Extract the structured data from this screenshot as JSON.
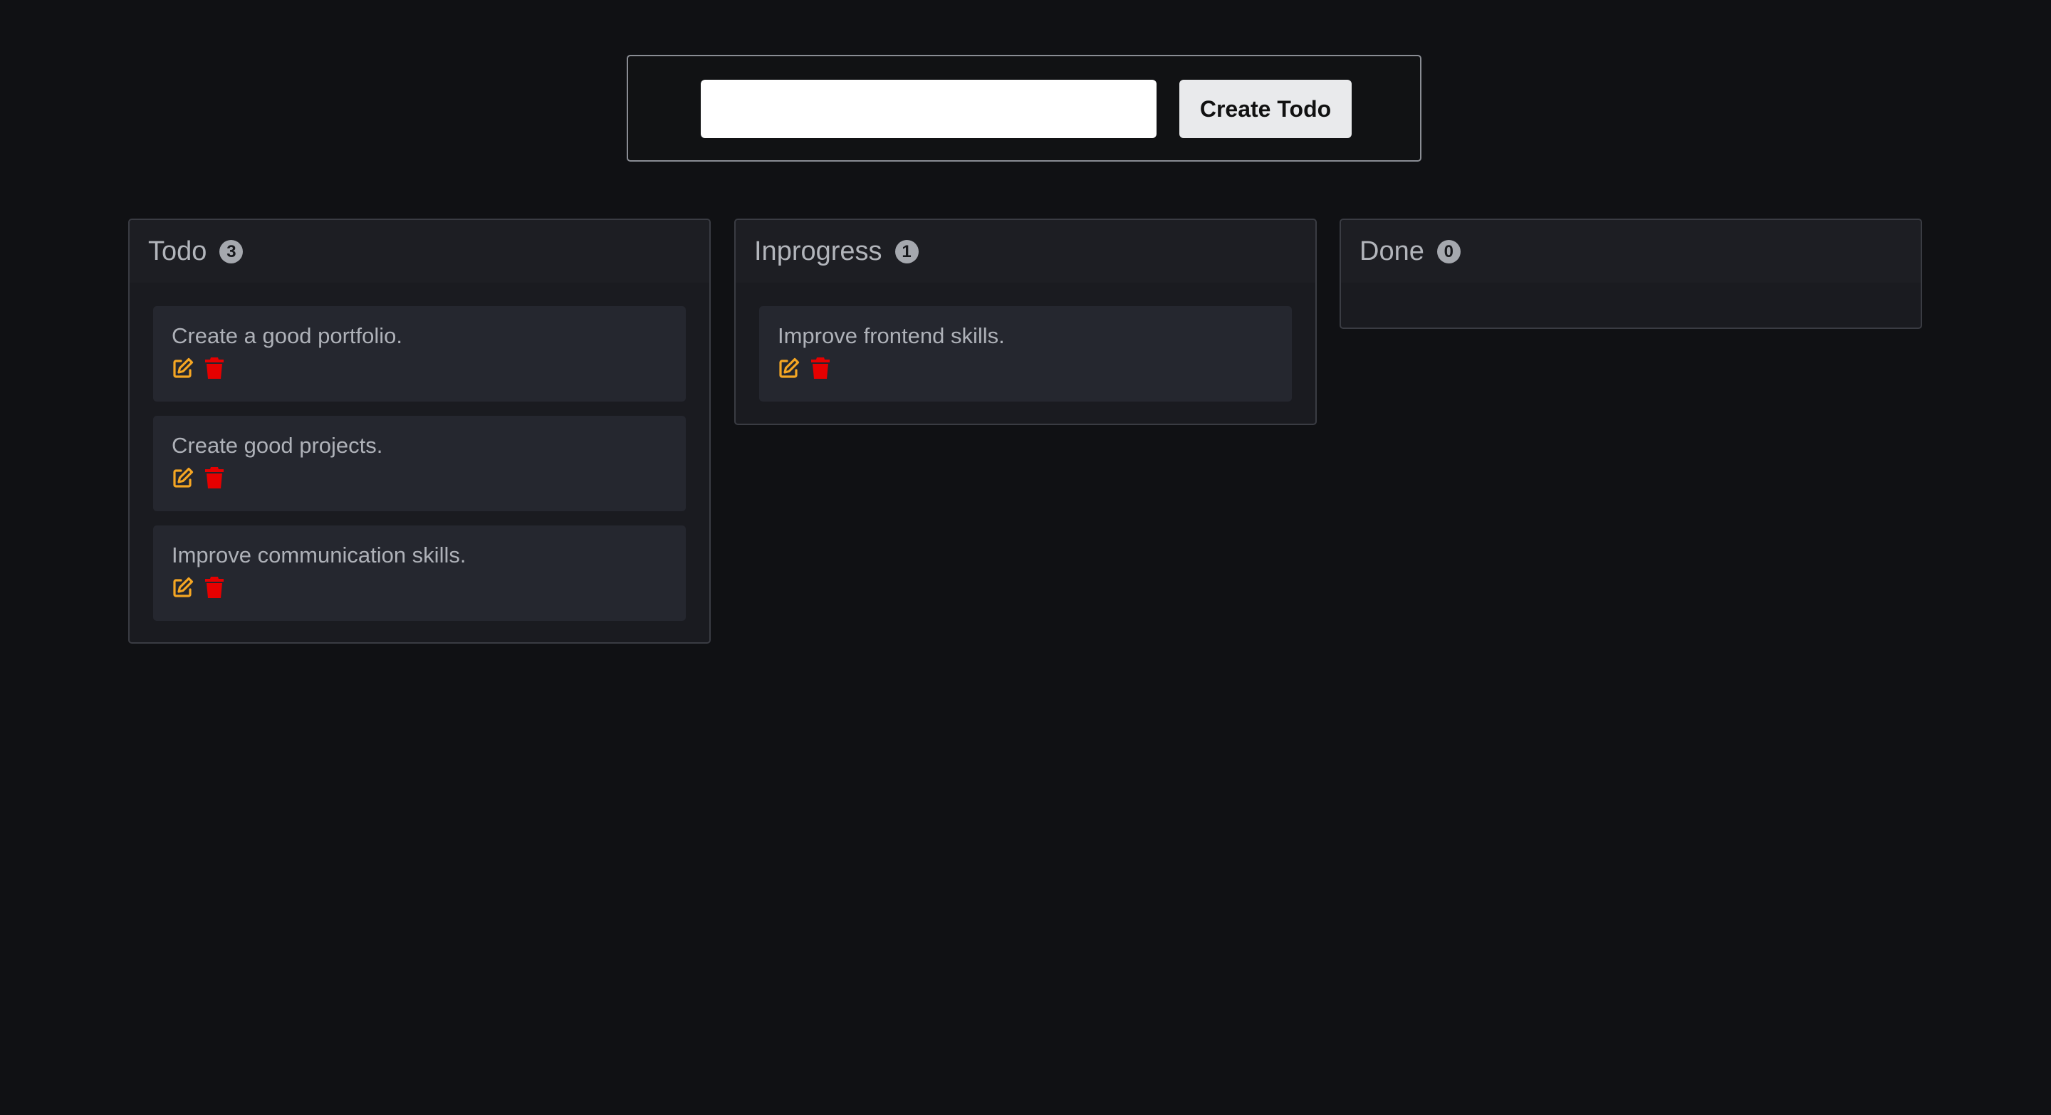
{
  "form": {
    "input_value": "",
    "input_placeholder": "",
    "button_label": "Create Todo"
  },
  "columns": [
    {
      "title": "Todo",
      "count": "3",
      "cards": [
        {
          "text": "Create a good portfolio."
        },
        {
          "text": "Create good projects."
        },
        {
          "text": "Improve communication skills."
        }
      ]
    },
    {
      "title": "Inprogress",
      "count": "1",
      "cards": [
        {
          "text": "Improve frontend skills."
        }
      ]
    },
    {
      "title": "Done",
      "count": "0",
      "cards": []
    }
  ],
  "icons": {
    "edit": "edit-icon",
    "delete": "trash-icon"
  },
  "colors": {
    "background": "#101114",
    "edit_icon": "#f5a623",
    "delete_icon": "#e60000",
    "card": "#25272f",
    "column": "#1a1b20"
  }
}
